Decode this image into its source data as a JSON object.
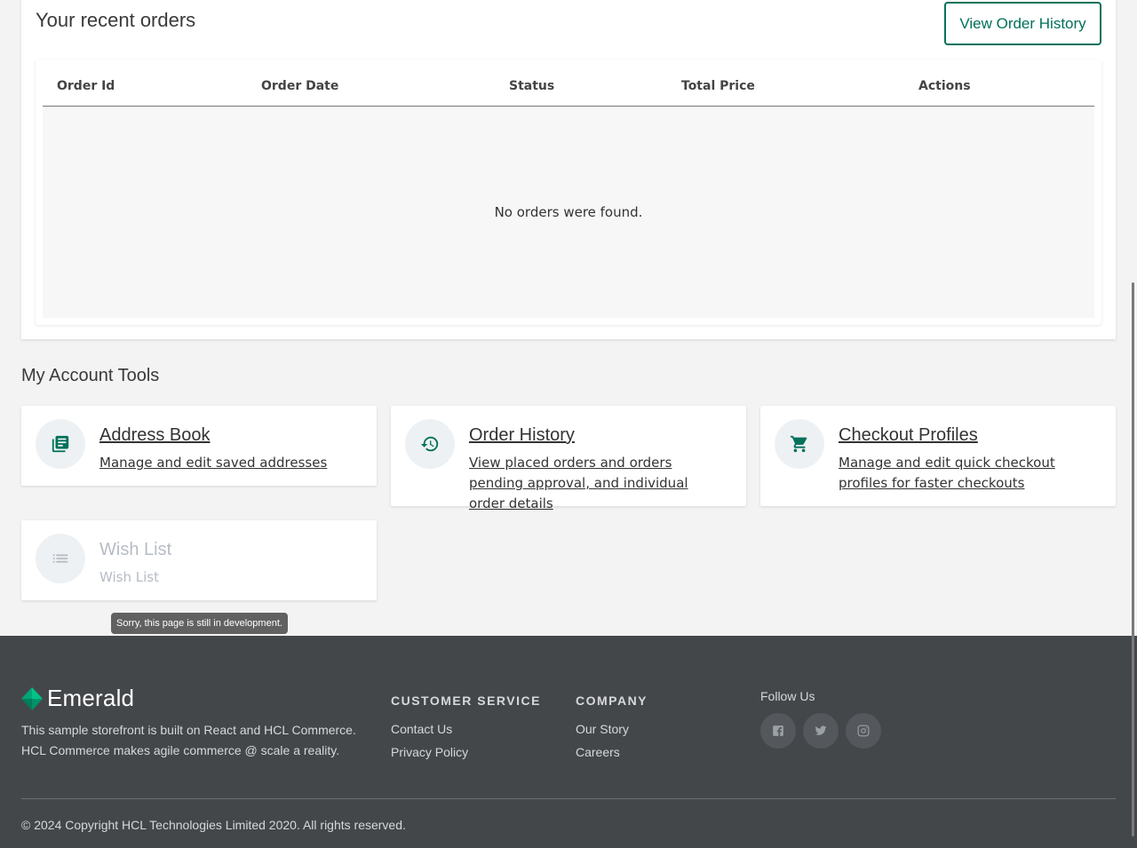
{
  "recent_orders": {
    "title": "Your recent orders",
    "view_history_label": "View Order History",
    "columns": [
      "Order Id",
      "Order Date",
      "Status",
      "Total Price",
      "Actions"
    ],
    "empty_message": "No orders were found."
  },
  "account_tools": {
    "title": "My Account Tools",
    "items": [
      {
        "name": "Address Book",
        "description": "Manage and edit saved addresses",
        "icon": "address-book-icon",
        "enabled": true
      },
      {
        "name": "Order History",
        "description": "View placed orders and orders pending approval, and individual order details",
        "icon": "history-icon",
        "enabled": true
      },
      {
        "name": "Checkout Profiles",
        "description": "Manage and edit quick checkout profiles for faster checkouts",
        "icon": "shopping-cart-icon",
        "enabled": true
      },
      {
        "name": "Wish List",
        "description": "Wish List",
        "icon": "list-icon",
        "enabled": false
      }
    ],
    "tooltip": "Sorry, this page is still in development."
  },
  "footer": {
    "brand": "Emerald",
    "description": "This sample storefront is built on React and HCL Commerce. HCL Commerce makes agile commerce @ scale a reality.",
    "customer_service": {
      "title": "CUSTOMER SERVICE",
      "links": [
        "Contact Us",
        "Privacy Policy"
      ]
    },
    "company": {
      "title": "COMPANY",
      "links": [
        "Our Story",
        "Careers"
      ]
    },
    "follow_us": "Follow Us",
    "social": [
      "facebook-icon",
      "twitter-icon",
      "instagram-icon"
    ],
    "copyright": "© 2024 Copyright HCL Technologies Limited 2020. All rights reserved."
  },
  "colors": {
    "accent": "#00715a",
    "footer_bg": "#44474a",
    "page_bg": "#f3f3f3",
    "disabled_text": "#b6bcc4",
    "logo_green": "#00a676"
  }
}
